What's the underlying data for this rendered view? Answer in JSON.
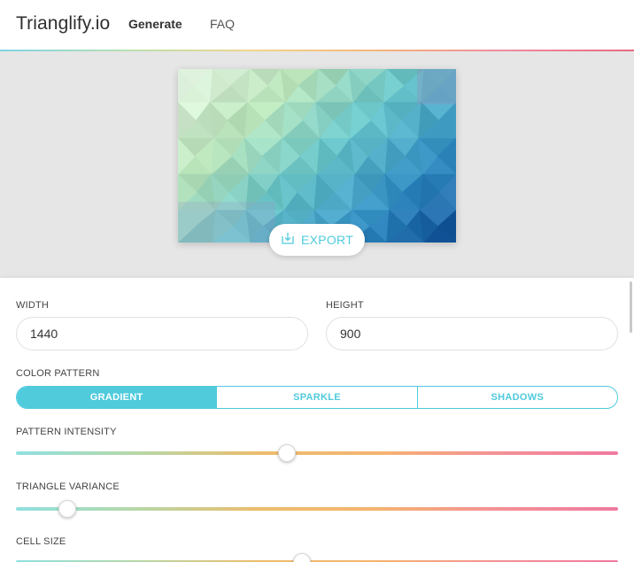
{
  "header": {
    "brand": "Trianglify.io",
    "nav": [
      {
        "label": "Generate",
        "active": true
      },
      {
        "label": "FAQ",
        "active": false
      }
    ]
  },
  "preview": {
    "export_label": "EXPORT",
    "export_icon": "download-icon"
  },
  "form": {
    "width": {
      "label": "WIDTH",
      "value": "1440"
    },
    "height": {
      "label": "HEIGHT",
      "value": "900"
    },
    "color_pattern": {
      "label": "COLOR PATTERN",
      "options": [
        "GRADIENT",
        "SPARKLE",
        "SHADOWS"
      ],
      "selected": "GRADIENT"
    },
    "pattern_intensity": {
      "label": "PATTERN INTENSITY",
      "value": 0.45
    },
    "triangle_variance": {
      "label": "TRIANGLE VARIANCE",
      "value": 0.085
    },
    "cell_size": {
      "label": "CELL SIZE",
      "value": 0.475
    }
  },
  "colors": {
    "accent": "#4fcbdc",
    "slider_gradient": [
      "#8fe0e0",
      "#b6d8a8",
      "#ebbd6e",
      "#f5b470",
      "#f49195",
      "#f07aa0"
    ]
  }
}
